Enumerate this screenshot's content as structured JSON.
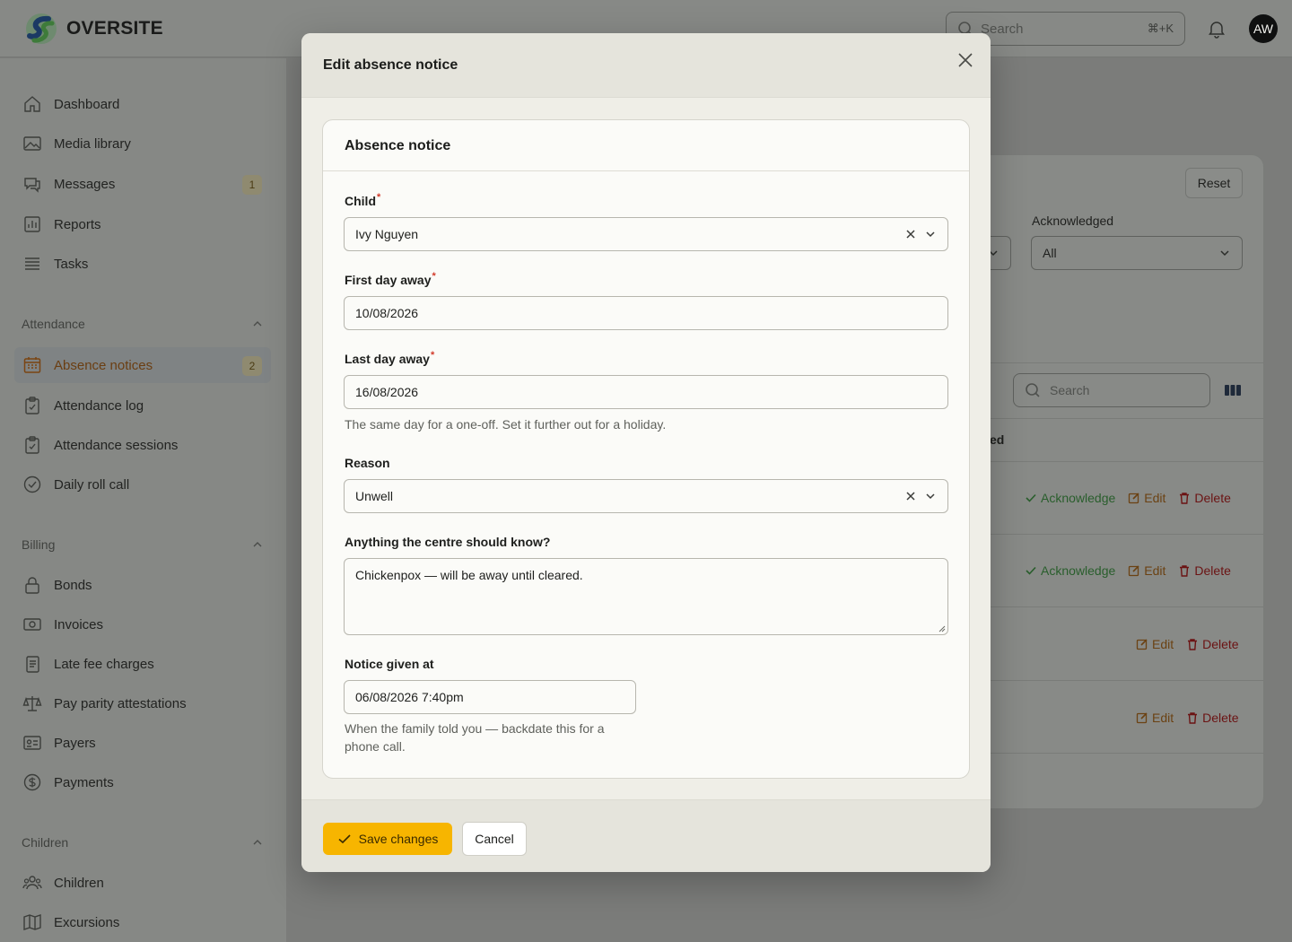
{
  "app": {
    "brand": "OVERSITE",
    "search_placeholder": "Search",
    "search_shortcut": "⌘+K",
    "avatar_initials": "AW"
  },
  "sidebar": {
    "main": [
      {
        "label": "Dashboard",
        "icon": "home-icon"
      },
      {
        "label": "Media library",
        "icon": "image-icon"
      },
      {
        "label": "Messages",
        "icon": "chat-icon",
        "badge": "1"
      },
      {
        "label": "Reports",
        "icon": "chart-icon"
      },
      {
        "label": "Tasks",
        "icon": "list-icon"
      }
    ],
    "attendance_group": "Attendance",
    "attendance": [
      {
        "label": "Absence notices",
        "icon": "calendar-icon",
        "badge": "2",
        "active": true
      },
      {
        "label": "Attendance log",
        "icon": "clipboard-icon"
      },
      {
        "label": "Attendance sessions",
        "icon": "clipboard-icon"
      },
      {
        "label": "Daily roll call",
        "icon": "check-circle-icon"
      }
    ],
    "billing_group": "Billing",
    "billing": [
      {
        "label": "Bonds",
        "icon": "lock-icon"
      },
      {
        "label": "Invoices",
        "icon": "banknote-icon"
      },
      {
        "label": "Late fee charges",
        "icon": "document-icon"
      },
      {
        "label": "Pay parity attestations",
        "icon": "scale-icon"
      },
      {
        "label": "Payers",
        "icon": "id-card-icon"
      },
      {
        "label": "Payments",
        "icon": "dollar-icon"
      }
    ],
    "children_group": "Children",
    "children": [
      {
        "label": "Children",
        "icon": "users-icon"
      },
      {
        "label": "Excursions",
        "icon": "map-icon"
      }
    ]
  },
  "background_panel": {
    "reset_label": "Reset",
    "acknowledged_label": "Acknowledged",
    "acknowledged_value": "All",
    "search_placeholder": "Search",
    "column_fragment": "ed",
    "acknowledge_label": "Acknowledge",
    "edit_label": "Edit",
    "delete_label": "Delete"
  },
  "modal": {
    "title": "Edit absence notice",
    "card_title": "Absence notice",
    "child_label": "Child",
    "child_value": "Ivy Nguyen",
    "first_day_label": "First day away",
    "first_day_value": "10/08/2026",
    "last_day_label": "Last day away",
    "last_day_value": "16/08/2026",
    "last_day_help": "The same day for a one-off. Set it further out for a holiday.",
    "reason_label": "Reason",
    "reason_value": "Unwell",
    "notes_label": "Anything the centre should know?",
    "notes_value": "Chickenpox — will be away until cleared.",
    "notice_label": "Notice given at",
    "notice_value": "06/08/2026 7:40pm",
    "notice_help_1": "When the family told you — backdate this for a",
    "notice_help_2": "phone call.",
    "required_mark": "*",
    "save_label": "Save changes",
    "cancel_label": "Cancel"
  },
  "colors": {
    "accent": "#f7b500",
    "modal_bg": "#e5e4dc",
    "card_bg": "#fbfbf8",
    "required": "#d23a2a"
  }
}
